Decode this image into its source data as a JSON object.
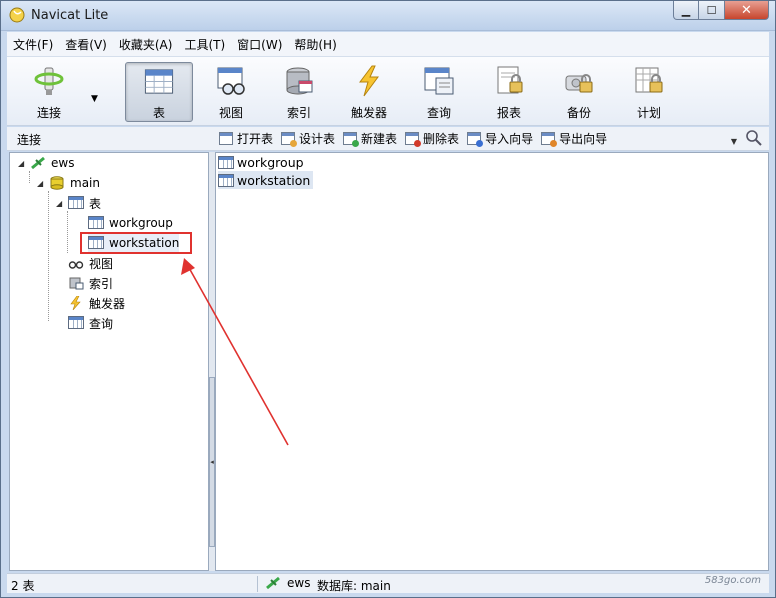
{
  "window": {
    "title": "Navicat Lite"
  },
  "menu": [
    "文件(F)",
    "查看(V)",
    "收藏夹(A)",
    "工具(T)",
    "窗口(W)",
    "帮助(H)"
  ],
  "toolbar": {
    "connect": "连接",
    "table": "表",
    "view": "视图",
    "index": "索引",
    "trigger": "触发器",
    "query": "查询",
    "report": "报表",
    "backup": "备份",
    "schedule": "计划"
  },
  "subbar": {
    "label": "连接",
    "actions": [
      "打开表",
      "设计表",
      "新建表",
      "删除表",
      "导入向导",
      "导出向导"
    ]
  },
  "tree": {
    "connection": "ews",
    "database": "main",
    "tables_group": "表",
    "tables": [
      "workgroup",
      "workstation"
    ],
    "views_group": "视图",
    "indexes_group": "索引",
    "triggers_group": "触发器",
    "queries_group": "查询"
  },
  "list": [
    "workgroup",
    "workstation"
  ],
  "status": {
    "count": "2 表",
    "connection": "ews",
    "database": "数据库: main",
    "watermark": "583go.com"
  },
  "colors": {
    "highlight": "#e0322f",
    "toolbar_active": "#c9d2de"
  }
}
